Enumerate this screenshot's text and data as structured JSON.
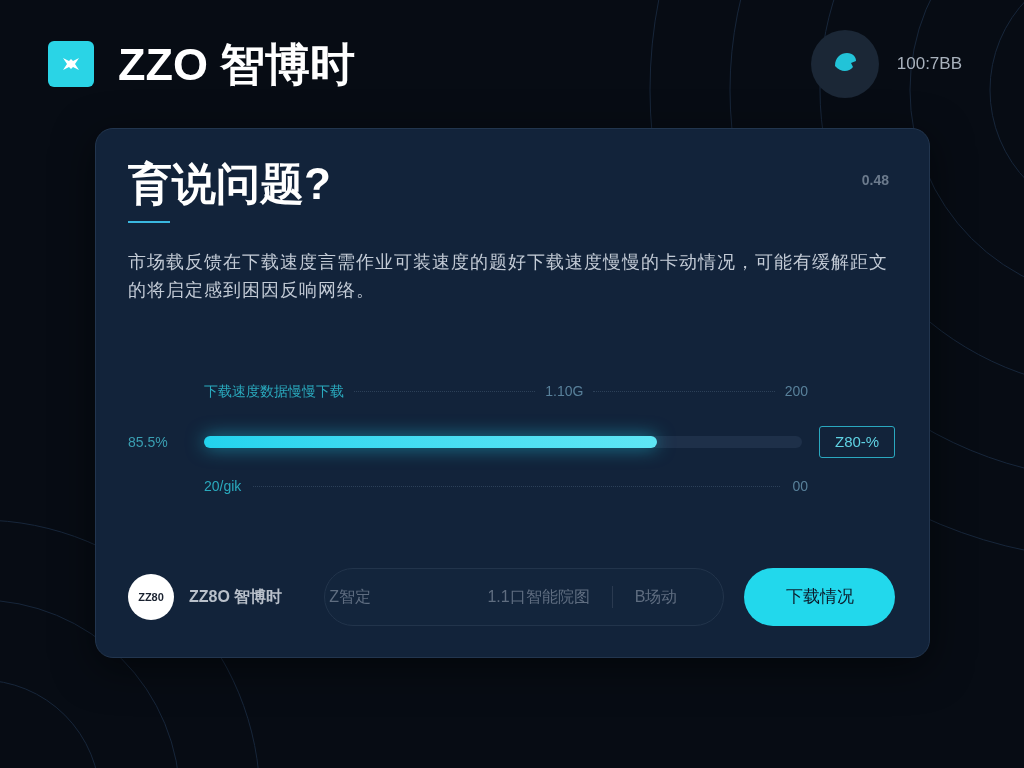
{
  "header": {
    "brand": "ZZO 智博时",
    "account": {
      "label": "100:7BB"
    }
  },
  "card": {
    "title": "育说问题?",
    "corner_text": "0.48",
    "description": "市场载反馈在下载速度言需作业可装速度的题好下载速度慢慢的卡动情况，可能有缓解距文的将启定感到困因反响网络。",
    "progress": {
      "top_labels": [
        "下载速度数据慢慢下载",
        "1.10G",
        "200"
      ],
      "left_label": "85.5%",
      "level": 0.757,
      "value_badge": "Z80-%",
      "bottom_labels": [
        "20/gik",
        "00"
      ]
    },
    "footer": {
      "logo_text": "ZZ80",
      "brand": "ZZ8O 智博时",
      "info": [
        "Z智定",
        "1.1口智能院图",
        "B场动"
      ],
      "button": "下载情况"
    }
  }
}
